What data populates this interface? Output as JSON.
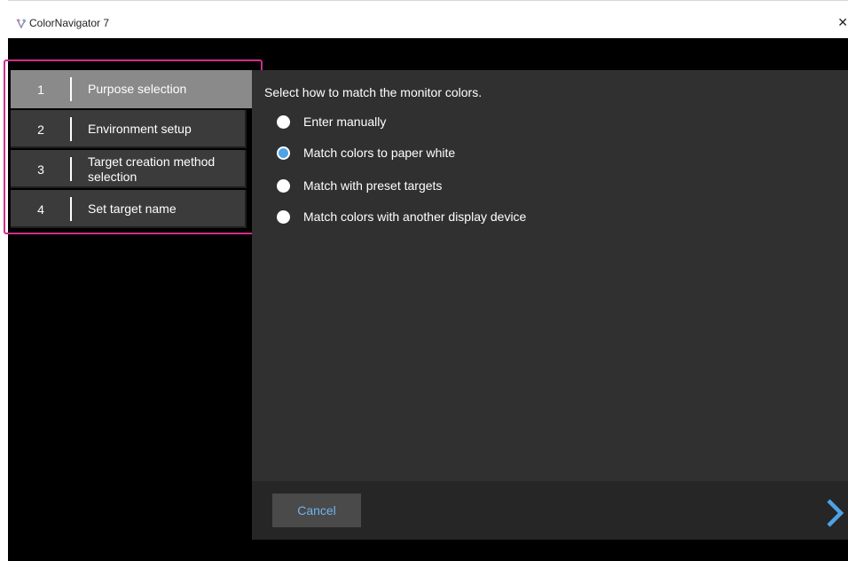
{
  "window": {
    "title": "ColorNavigator 7",
    "close_glyph": "✕"
  },
  "steps": [
    {
      "number": "1",
      "label": "Purpose selection",
      "active": true
    },
    {
      "number": "2",
      "label": "Environment setup",
      "active": false
    },
    {
      "number": "3",
      "label": "Target creation method selection",
      "active": false
    },
    {
      "number": "4",
      "label": "Set target name",
      "active": false
    }
  ],
  "content": {
    "prompt": "Select how to match the monitor colors.",
    "options": [
      {
        "label": "Enter manually",
        "selected": false
      },
      {
        "label": "Match colors to paper white",
        "selected": true
      },
      {
        "label": "Match with preset targets",
        "selected": false
      },
      {
        "label": "Match colors with another display device",
        "selected": false
      }
    ]
  },
  "footer": {
    "cancel_label": "Cancel",
    "next_icon": "chevron-right-icon"
  },
  "colors": {
    "accent_blue": "#4da3e6",
    "highlight_frame": "#d12d8c",
    "active_step": "#8a8a8a",
    "inactive_step": "#3b3b3b",
    "panel": "#303030"
  }
}
